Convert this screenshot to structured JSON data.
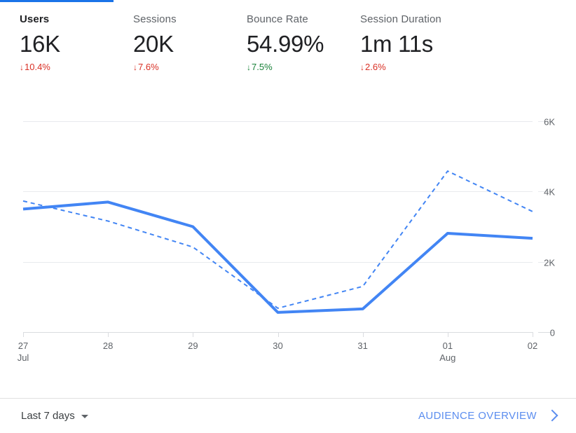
{
  "accent_color": "#1a73e8",
  "tab_indicator": {
    "name": "active-tab-underline",
    "color": "#1a73e8"
  },
  "metrics": [
    {
      "label": "Users",
      "value": "16K",
      "delta": "10.4%",
      "direction": "down",
      "delta_color": "#d93025",
      "arrow": "↓"
    },
    {
      "label": "Sessions",
      "value": "20K",
      "delta": "7.6%",
      "direction": "down",
      "delta_color": "#d93025",
      "arrow": "↓"
    },
    {
      "label": "Bounce Rate",
      "value": "54.99%",
      "delta": "7.5%",
      "direction": "up",
      "delta_color": "#188038",
      "arrow": "↓"
    },
    {
      "label": "Session Duration",
      "value": "1m 11s",
      "delta": "2.6%",
      "direction": "down",
      "delta_color": "#d93025",
      "arrow": "↓"
    }
  ],
  "chart_data": {
    "type": "line",
    "title": "",
    "xlabel": "",
    "ylabel": "",
    "ylim": [
      0,
      6000
    ],
    "yticks": [
      0,
      2000,
      4000,
      6000
    ],
    "ytick_labels": [
      "0",
      "2K",
      "4K",
      "6K"
    ],
    "grid": true,
    "legend": "none",
    "y_axis_position": "right",
    "categories": [
      "27",
      "28",
      "29",
      "30",
      "31",
      "01",
      "02"
    ],
    "category_sublabels": [
      "Jul",
      "",
      "",
      "",
      "",
      "Aug",
      ""
    ],
    "series": [
      {
        "name": "Users (current period)",
        "style": "solid",
        "color": "#4285f4",
        "values": [
          3500,
          3700,
          3000,
          560,
          660,
          2810,
          2670
        ]
      },
      {
        "name": "Users (previous period)",
        "style": "dashed",
        "color": "#4285f4",
        "values": [
          3730,
          3160,
          2420,
          680,
          1300,
          4580,
          3430
        ]
      }
    ]
  },
  "footer": {
    "date_range_label": "Last 7 days",
    "overview_link_label": "AUDIENCE OVERVIEW",
    "link_color": "#5b8def"
  }
}
